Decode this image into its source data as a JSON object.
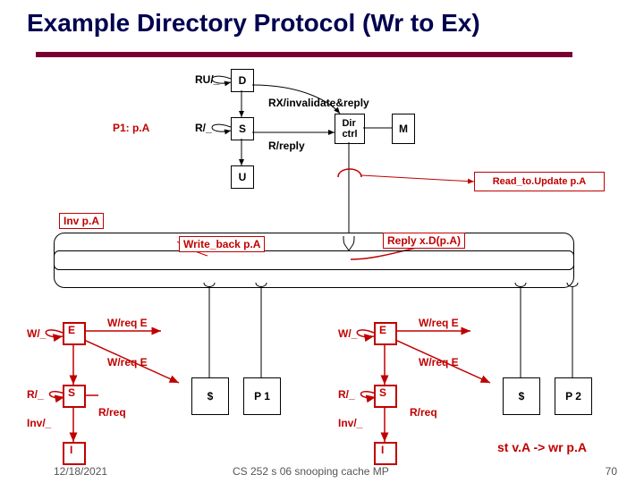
{
  "title": "Example Directory Protocol (Wr to Ex)",
  "dir": {
    "D": "D",
    "RU": "RU/_",
    "RXinv": "RX/invalidate&reply",
    "S": "S",
    "R": "R/_",
    "P1pA": "P1: p.A",
    "Rreply": "R/reply",
    "U": "U",
    "Dir": "Dir\nctrl",
    "M": "M",
    "ReadUpd": "Read_to.Update p.A"
  },
  "bus": {
    "InvpA": "Inv p.A",
    "Wback": "Write_back p.A",
    "ReplyD": "Reply x.D(p.A)"
  },
  "sm": {
    "E": "E",
    "W": "W/_",
    "WreqE": "W/req E",
    "S": "S",
    "R": "R/_",
    "Inv": "Inv/_",
    "Rreq": "R/req",
    "I": "I"
  },
  "procs": {
    "dol": "$",
    "P1": "P 1",
    "P2": "P 2"
  },
  "action": "st v.A -> wr p.A",
  "footer": {
    "date": "12/18/2021",
    "course": "CS 252 s 06 snooping cache MP",
    "page": "70"
  }
}
